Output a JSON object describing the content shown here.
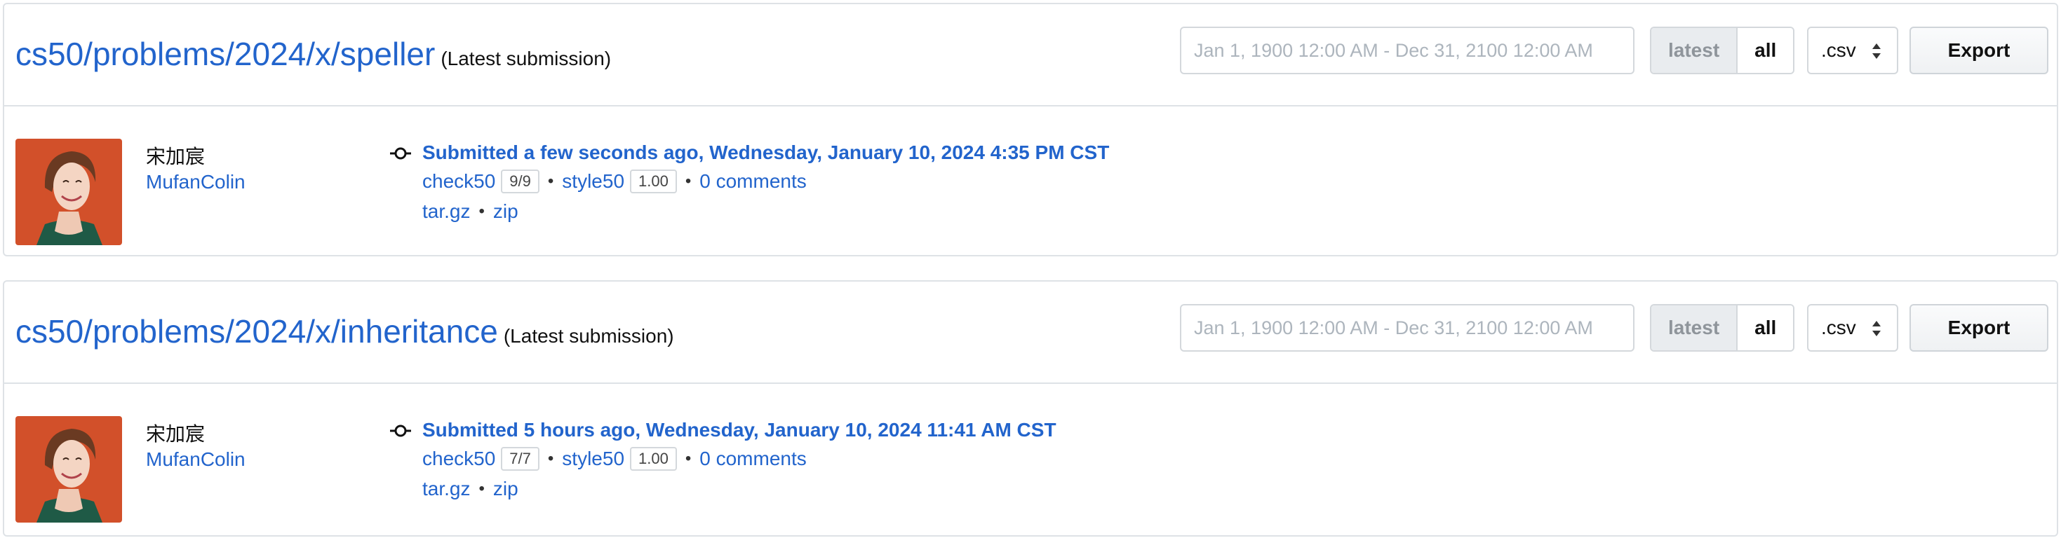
{
  "colors": {
    "link": "#2264cc",
    "border": "#dee2e6",
    "muted": "#adb5bd",
    "active_toggle_bg": "#e9ecef",
    "avatar_bg": "#d2502a"
  },
  "submissions": [
    {
      "problem": "cs50/problems/2024/x/speller",
      "suffix": "(Latest submission)",
      "filter": {
        "date_range_placeholder": "Jan 1, 1900 12:00 AM - Dec 31, 2100 12:00 AM",
        "latest_label": "latest",
        "all_label": "all",
        "format": ".csv",
        "export_label": "Export"
      },
      "user": {
        "name": "宋加宸",
        "handle": "MufanColin",
        "avatar_icon": "user-avatar-icon"
      },
      "commit_icon": "git-commit-icon",
      "submitted": "Submitted a few seconds ago, Wednesday, January 10, 2024 4:35 PM CST",
      "check50": {
        "label": "check50",
        "score": "9/9"
      },
      "style50": {
        "label": "style50",
        "score": "1.00"
      },
      "comments": "0 comments",
      "downloads": {
        "targz": "tar.gz",
        "zip": "zip"
      }
    },
    {
      "problem": "cs50/problems/2024/x/inheritance",
      "suffix": "(Latest submission)",
      "filter": {
        "date_range_placeholder": "Jan 1, 1900 12:00 AM - Dec 31, 2100 12:00 AM",
        "latest_label": "latest",
        "all_label": "all",
        "format": ".csv",
        "export_label": "Export"
      },
      "user": {
        "name": "宋加宸",
        "handle": "MufanColin",
        "avatar_icon": "user-avatar-icon"
      },
      "commit_icon": "git-commit-icon",
      "submitted": "Submitted 5 hours ago, Wednesday, January 10, 2024 11:41 AM CST",
      "check50": {
        "label": "check50",
        "score": "7/7"
      },
      "style50": {
        "label": "style50",
        "score": "1.00"
      },
      "comments": "0 comments",
      "downloads": {
        "targz": "tar.gz",
        "zip": "zip"
      }
    }
  ]
}
